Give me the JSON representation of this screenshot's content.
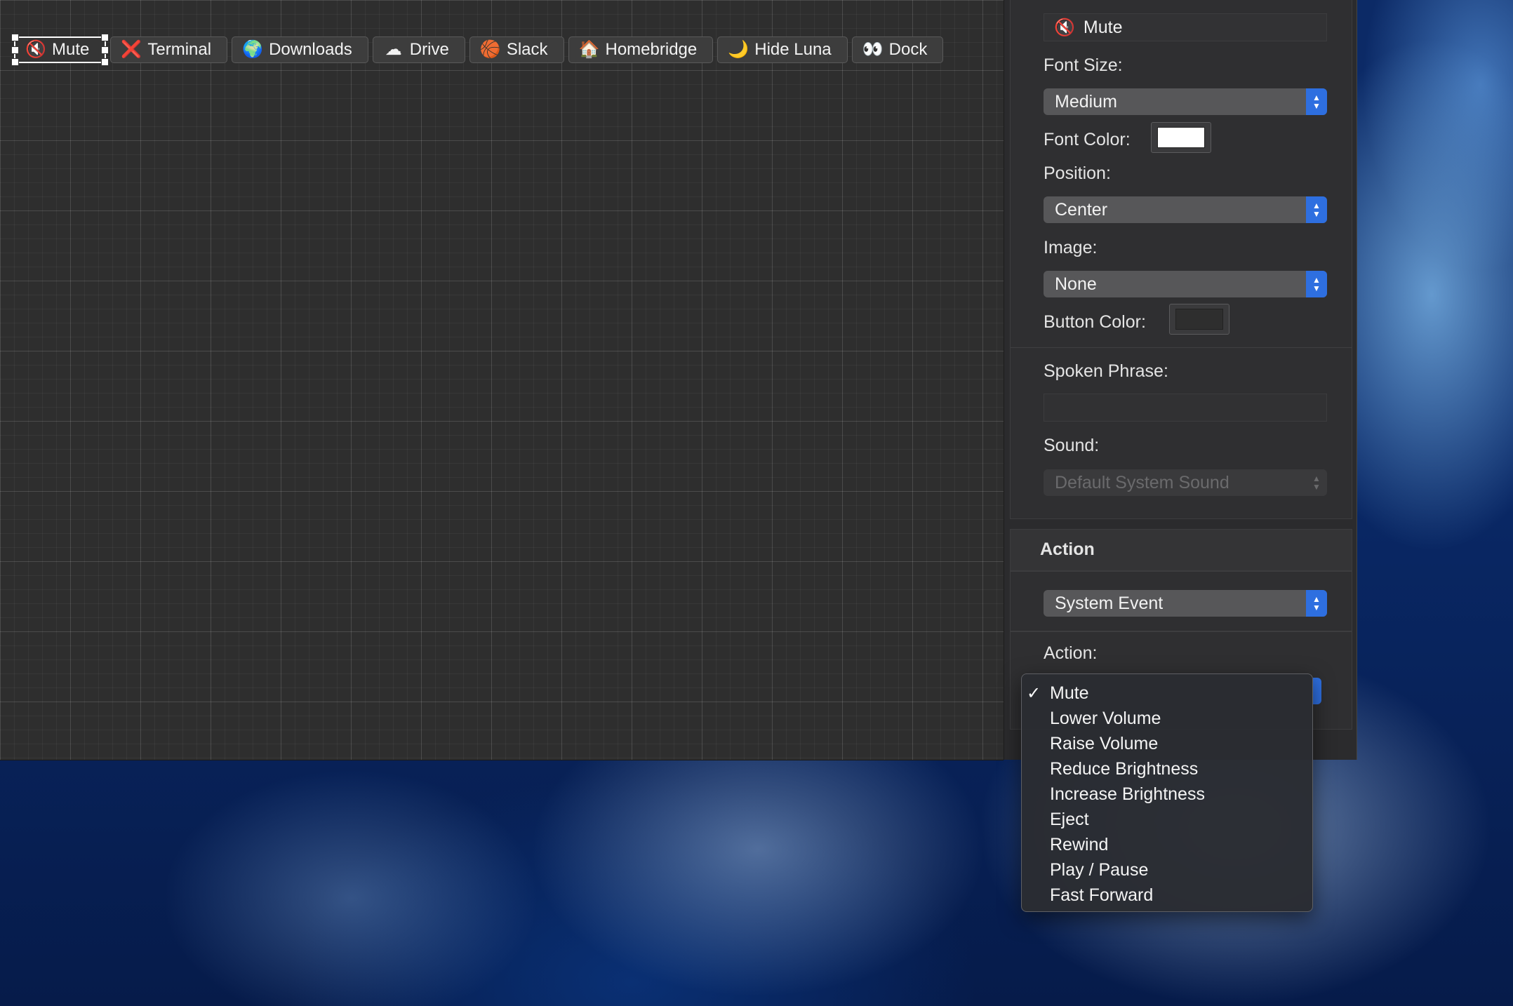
{
  "touchbar": {
    "buttons": [
      {
        "label": "Mute",
        "icon": "muted-speaker-icon",
        "glyph": "🔇",
        "selected": true
      },
      {
        "label": "Terminal",
        "icon": "red-x-icon",
        "glyph": "❌"
      },
      {
        "label": "Downloads",
        "icon": "globe-icon",
        "glyph": "🌍"
      },
      {
        "label": "Drive",
        "icon": "cloud-icon",
        "glyph": "☁"
      },
      {
        "label": "Slack",
        "icon": "basketball-icon",
        "glyph": "🏀"
      },
      {
        "label": "Homebridge",
        "icon": "house-icon",
        "glyph": "🏠"
      },
      {
        "label": "Hide Luna",
        "icon": "moon-icon",
        "glyph": "🌙"
      },
      {
        "label": "Dock",
        "icon": "eyes-icon",
        "glyph": "👀"
      }
    ]
  },
  "inspector": {
    "title_field": {
      "value": "Mute",
      "icon": "muted-speaker-icon",
      "glyph": "🔇"
    },
    "font_size": {
      "label": "Font Size:",
      "value": "Medium"
    },
    "font_color": {
      "label": "Font Color:",
      "color": "#ffffff"
    },
    "position": {
      "label": "Position:",
      "value": "Center"
    },
    "image": {
      "label": "Image:",
      "value": "None"
    },
    "button_color": {
      "label": "Button Color:",
      "color": "#2e2e2e"
    },
    "spoken_phrase": {
      "label": "Spoken Phrase:",
      "value": ""
    },
    "sound": {
      "label": "Sound:",
      "value": "Default System Sound",
      "enabled": false
    },
    "action_section": {
      "header": "Action",
      "type_value": "System Event"
    },
    "action": {
      "label": "Action:"
    }
  },
  "action_menu": {
    "selected_index": 0,
    "check_glyph": "✓",
    "items": [
      "Mute",
      "Lower Volume",
      "Raise Volume",
      "Reduce Brightness",
      "Increase Brightness",
      "Eject",
      "Rewind",
      "Play / Pause",
      "Fast Forward"
    ]
  },
  "colors": {
    "accent": "#2e6fe0",
    "panel_bg": "#2b2b2d",
    "canvas_bg": "#2e2e2e"
  }
}
